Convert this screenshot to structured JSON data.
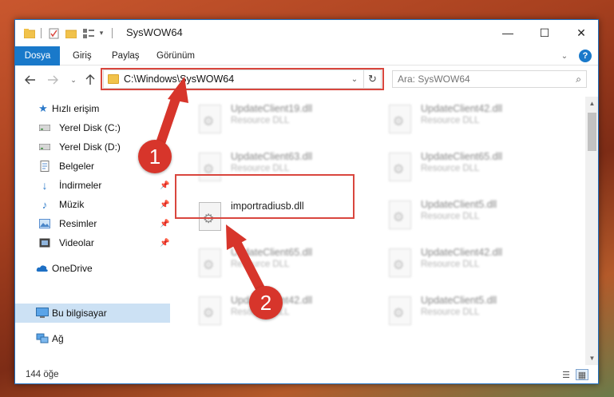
{
  "window": {
    "title": "SysWOW64",
    "minimize": "—",
    "maximize": "☐",
    "close": "✕"
  },
  "ribbon": {
    "tabs": [
      "Dosya",
      "Giriş",
      "Paylaş",
      "Görünüm"
    ]
  },
  "address": {
    "path": "C:\\Windows\\SysWOW64"
  },
  "search": {
    "placeholder": "Ara: SysWOW64"
  },
  "sidebar": {
    "items": [
      {
        "label": "Hızlı erişim",
        "icon": "star-icon"
      },
      {
        "label": "Yerel Disk (C:)",
        "icon": "drive-icon"
      },
      {
        "label": "Yerel Disk (D:)",
        "icon": "drive-icon"
      },
      {
        "label": "Belgeler",
        "icon": "documents-icon"
      },
      {
        "label": "İndirmeler",
        "icon": "download-icon"
      },
      {
        "label": "Müzik",
        "icon": "music-icon"
      },
      {
        "label": "Resimler",
        "icon": "pictures-icon"
      },
      {
        "label": "Videolar",
        "icon": "videos-icon"
      },
      {
        "label": "OneDrive",
        "icon": "cloud-icon"
      },
      {
        "label": "Bu bilgisayar",
        "icon": "computer-icon"
      },
      {
        "label": "Ağ",
        "icon": "network-icon"
      }
    ]
  },
  "files": [
    {
      "name": "UpdateClient19.dll",
      "type": "Resource DLL"
    },
    {
      "name": "UpdateClient42.dll",
      "type": "Resource DLL"
    },
    {
      "name": "UpdateClient63.dll",
      "type": "Resource DLL"
    },
    {
      "name": "UpdateClient65.dll",
      "type": "Resource DLL"
    },
    {
      "name": "importradiusb.dll",
      "type": ""
    },
    {
      "name": "UpdateClient5.dll",
      "type": "Resource DLL"
    },
    {
      "name": "UpdateClient65.dll",
      "type": "Resource DLL"
    },
    {
      "name": "UpdateClient42.dll",
      "type": "Resource DLL"
    },
    {
      "name": "UpdateClient42.dll",
      "type": "Resource DLL"
    },
    {
      "name": "UpdateClient5.dll",
      "type": "Resource DLL"
    }
  ],
  "status": {
    "count": "144 öğe"
  },
  "annotations": {
    "step1": "1",
    "step2": "2",
    "color": "#d7352b"
  }
}
